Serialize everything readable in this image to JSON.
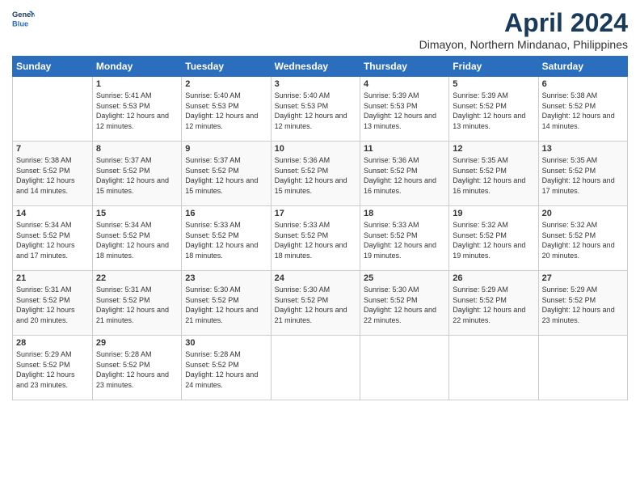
{
  "logo": {
    "line1": "General",
    "line2": "Blue"
  },
  "title": "April 2024",
  "location": "Dimayon, Northern Mindanao, Philippines",
  "days_of_week": [
    "Sunday",
    "Monday",
    "Tuesday",
    "Wednesday",
    "Thursday",
    "Friday",
    "Saturday"
  ],
  "weeks": [
    [
      {
        "num": "",
        "sunrise": "",
        "sunset": "",
        "daylight": ""
      },
      {
        "num": "1",
        "sunrise": "Sunrise: 5:41 AM",
        "sunset": "Sunset: 5:53 PM",
        "daylight": "Daylight: 12 hours and 12 minutes."
      },
      {
        "num": "2",
        "sunrise": "Sunrise: 5:40 AM",
        "sunset": "Sunset: 5:53 PM",
        "daylight": "Daylight: 12 hours and 12 minutes."
      },
      {
        "num": "3",
        "sunrise": "Sunrise: 5:40 AM",
        "sunset": "Sunset: 5:53 PM",
        "daylight": "Daylight: 12 hours and 12 minutes."
      },
      {
        "num": "4",
        "sunrise": "Sunrise: 5:39 AM",
        "sunset": "Sunset: 5:53 PM",
        "daylight": "Daylight: 12 hours and 13 minutes."
      },
      {
        "num": "5",
        "sunrise": "Sunrise: 5:39 AM",
        "sunset": "Sunset: 5:52 PM",
        "daylight": "Daylight: 12 hours and 13 minutes."
      },
      {
        "num": "6",
        "sunrise": "Sunrise: 5:38 AM",
        "sunset": "Sunset: 5:52 PM",
        "daylight": "Daylight: 12 hours and 14 minutes."
      }
    ],
    [
      {
        "num": "7",
        "sunrise": "Sunrise: 5:38 AM",
        "sunset": "Sunset: 5:52 PM",
        "daylight": "Daylight: 12 hours and 14 minutes."
      },
      {
        "num": "8",
        "sunrise": "Sunrise: 5:37 AM",
        "sunset": "Sunset: 5:52 PM",
        "daylight": "Daylight: 12 hours and 15 minutes."
      },
      {
        "num": "9",
        "sunrise": "Sunrise: 5:37 AM",
        "sunset": "Sunset: 5:52 PM",
        "daylight": "Daylight: 12 hours and 15 minutes."
      },
      {
        "num": "10",
        "sunrise": "Sunrise: 5:36 AM",
        "sunset": "Sunset: 5:52 PM",
        "daylight": "Daylight: 12 hours and 15 minutes."
      },
      {
        "num": "11",
        "sunrise": "Sunrise: 5:36 AM",
        "sunset": "Sunset: 5:52 PM",
        "daylight": "Daylight: 12 hours and 16 minutes."
      },
      {
        "num": "12",
        "sunrise": "Sunrise: 5:35 AM",
        "sunset": "Sunset: 5:52 PM",
        "daylight": "Daylight: 12 hours and 16 minutes."
      },
      {
        "num": "13",
        "sunrise": "Sunrise: 5:35 AM",
        "sunset": "Sunset: 5:52 PM",
        "daylight": "Daylight: 12 hours and 17 minutes."
      }
    ],
    [
      {
        "num": "14",
        "sunrise": "Sunrise: 5:34 AM",
        "sunset": "Sunset: 5:52 PM",
        "daylight": "Daylight: 12 hours and 17 minutes."
      },
      {
        "num": "15",
        "sunrise": "Sunrise: 5:34 AM",
        "sunset": "Sunset: 5:52 PM",
        "daylight": "Daylight: 12 hours and 18 minutes."
      },
      {
        "num": "16",
        "sunrise": "Sunrise: 5:33 AM",
        "sunset": "Sunset: 5:52 PM",
        "daylight": "Daylight: 12 hours and 18 minutes."
      },
      {
        "num": "17",
        "sunrise": "Sunrise: 5:33 AM",
        "sunset": "Sunset: 5:52 PM",
        "daylight": "Daylight: 12 hours and 18 minutes."
      },
      {
        "num": "18",
        "sunrise": "Sunrise: 5:33 AM",
        "sunset": "Sunset: 5:52 PM",
        "daylight": "Daylight: 12 hours and 19 minutes."
      },
      {
        "num": "19",
        "sunrise": "Sunrise: 5:32 AM",
        "sunset": "Sunset: 5:52 PM",
        "daylight": "Daylight: 12 hours and 19 minutes."
      },
      {
        "num": "20",
        "sunrise": "Sunrise: 5:32 AM",
        "sunset": "Sunset: 5:52 PM",
        "daylight": "Daylight: 12 hours and 20 minutes."
      }
    ],
    [
      {
        "num": "21",
        "sunrise": "Sunrise: 5:31 AM",
        "sunset": "Sunset: 5:52 PM",
        "daylight": "Daylight: 12 hours and 20 minutes."
      },
      {
        "num": "22",
        "sunrise": "Sunrise: 5:31 AM",
        "sunset": "Sunset: 5:52 PM",
        "daylight": "Daylight: 12 hours and 21 minutes."
      },
      {
        "num": "23",
        "sunrise": "Sunrise: 5:30 AM",
        "sunset": "Sunset: 5:52 PM",
        "daylight": "Daylight: 12 hours and 21 minutes."
      },
      {
        "num": "24",
        "sunrise": "Sunrise: 5:30 AM",
        "sunset": "Sunset: 5:52 PM",
        "daylight": "Daylight: 12 hours and 21 minutes."
      },
      {
        "num": "25",
        "sunrise": "Sunrise: 5:30 AM",
        "sunset": "Sunset: 5:52 PM",
        "daylight": "Daylight: 12 hours and 22 minutes."
      },
      {
        "num": "26",
        "sunrise": "Sunrise: 5:29 AM",
        "sunset": "Sunset: 5:52 PM",
        "daylight": "Daylight: 12 hours and 22 minutes."
      },
      {
        "num": "27",
        "sunrise": "Sunrise: 5:29 AM",
        "sunset": "Sunset: 5:52 PM",
        "daylight": "Daylight: 12 hours and 23 minutes."
      }
    ],
    [
      {
        "num": "28",
        "sunrise": "Sunrise: 5:29 AM",
        "sunset": "Sunset: 5:52 PM",
        "daylight": "Daylight: 12 hours and 23 minutes."
      },
      {
        "num": "29",
        "sunrise": "Sunrise: 5:28 AM",
        "sunset": "Sunset: 5:52 PM",
        "daylight": "Daylight: 12 hours and 23 minutes."
      },
      {
        "num": "30",
        "sunrise": "Sunrise: 5:28 AM",
        "sunset": "Sunset: 5:52 PM",
        "daylight": "Daylight: 12 hours and 24 minutes."
      },
      {
        "num": "",
        "sunrise": "",
        "sunset": "",
        "daylight": ""
      },
      {
        "num": "",
        "sunrise": "",
        "sunset": "",
        "daylight": ""
      },
      {
        "num": "",
        "sunrise": "",
        "sunset": "",
        "daylight": ""
      },
      {
        "num": "",
        "sunrise": "",
        "sunset": "",
        "daylight": ""
      }
    ]
  ]
}
